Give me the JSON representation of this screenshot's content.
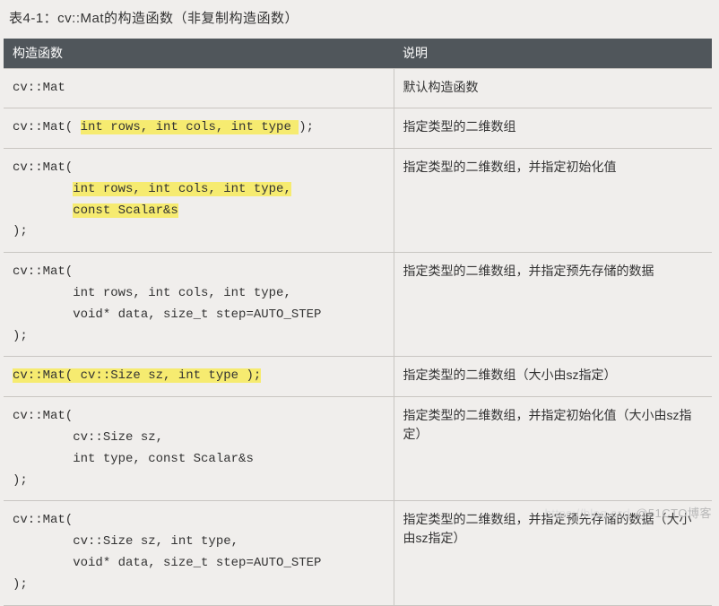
{
  "caption": "表4-1：cv::Mat的构造函数（非复制构造函数）",
  "headers": {
    "sig": "构造函数",
    "desc": "说明"
  },
  "rows": {
    "r1": {
      "sig_plain": "cv::Mat",
      "desc": "默认构造函数"
    },
    "r2": {
      "sig_pre": "cv::Mat( ",
      "sig_hl": "int rows, int cols, int type ",
      "sig_post": ");",
      "desc": "指定类型的二维数组"
    },
    "r3": {
      "line1": "cv::Mat(",
      "indent": "        ",
      "hl1": "int rows, int cols, int type,",
      "hl2": "const Scalar&s",
      "close": ");",
      "desc": "指定类型的二维数组，并指定初始化值"
    },
    "r4": {
      "line1": "cv::Mat(",
      "line2": "        int rows, int cols, int type,",
      "line3": "        void* data, size_t step=AUTO_STEP",
      "close": ");",
      "desc": "指定类型的二维数组，并指定预先存储的数据"
    },
    "r5": {
      "hl": "cv::Mat( cv::Size sz, int type );",
      "desc": "指定类型的二维数组（大小由sz指定）"
    },
    "r6": {
      "line1": "cv::Mat(",
      "line2": "        cv::Size sz,",
      "line3": "        int type, const Scalar&s",
      "close": ");",
      "desc": "指定类型的二维数组，并指定初始化值（大小由sz指定）"
    },
    "r7": {
      "line1": "cv::Mat(",
      "line2": "        cv::Size sz, int type,",
      "line3": "        void* data, size_t step=AUTO_STEP",
      "close": ");",
      "desc": "指定类型的二维数组，并指定预先存储的数据（大小由sz指定）"
    }
  },
  "watermark": {
    "ghost": "https://blog.csd",
    "main": "@51CTO博客"
  }
}
